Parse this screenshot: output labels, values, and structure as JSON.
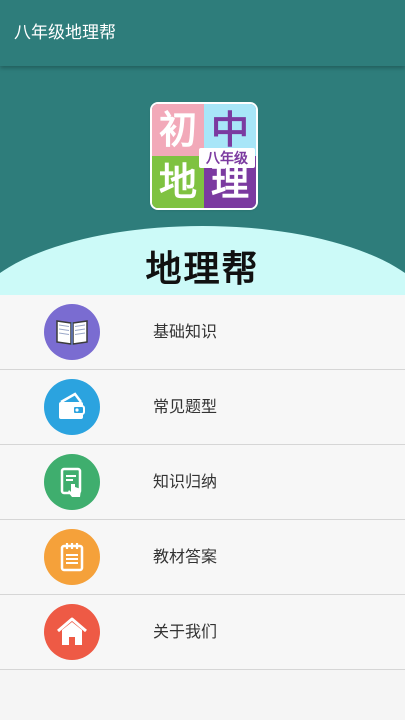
{
  "appbar": {
    "title": "八年级地理帮"
  },
  "header": {
    "logo": {
      "top_left": "初",
      "top_right": "中",
      "bottom_left": "地",
      "bottom_right": "理",
      "badge": "八年级"
    },
    "app_name": "地理帮"
  },
  "menu": {
    "items": [
      {
        "label": "基础知识",
        "icon": "book-icon",
        "color": "#7a6cd1"
      },
      {
        "label": "常见题型",
        "icon": "wallet-icon",
        "color": "#2ba3df"
      },
      {
        "label": "知识归纳",
        "icon": "touch-document-icon",
        "color": "#3fae6e"
      },
      {
        "label": "教材答案",
        "icon": "notepad-icon",
        "color": "#f5a13a"
      },
      {
        "label": "关于我们",
        "icon": "home-icon",
        "color": "#ee5a45"
      }
    ]
  }
}
